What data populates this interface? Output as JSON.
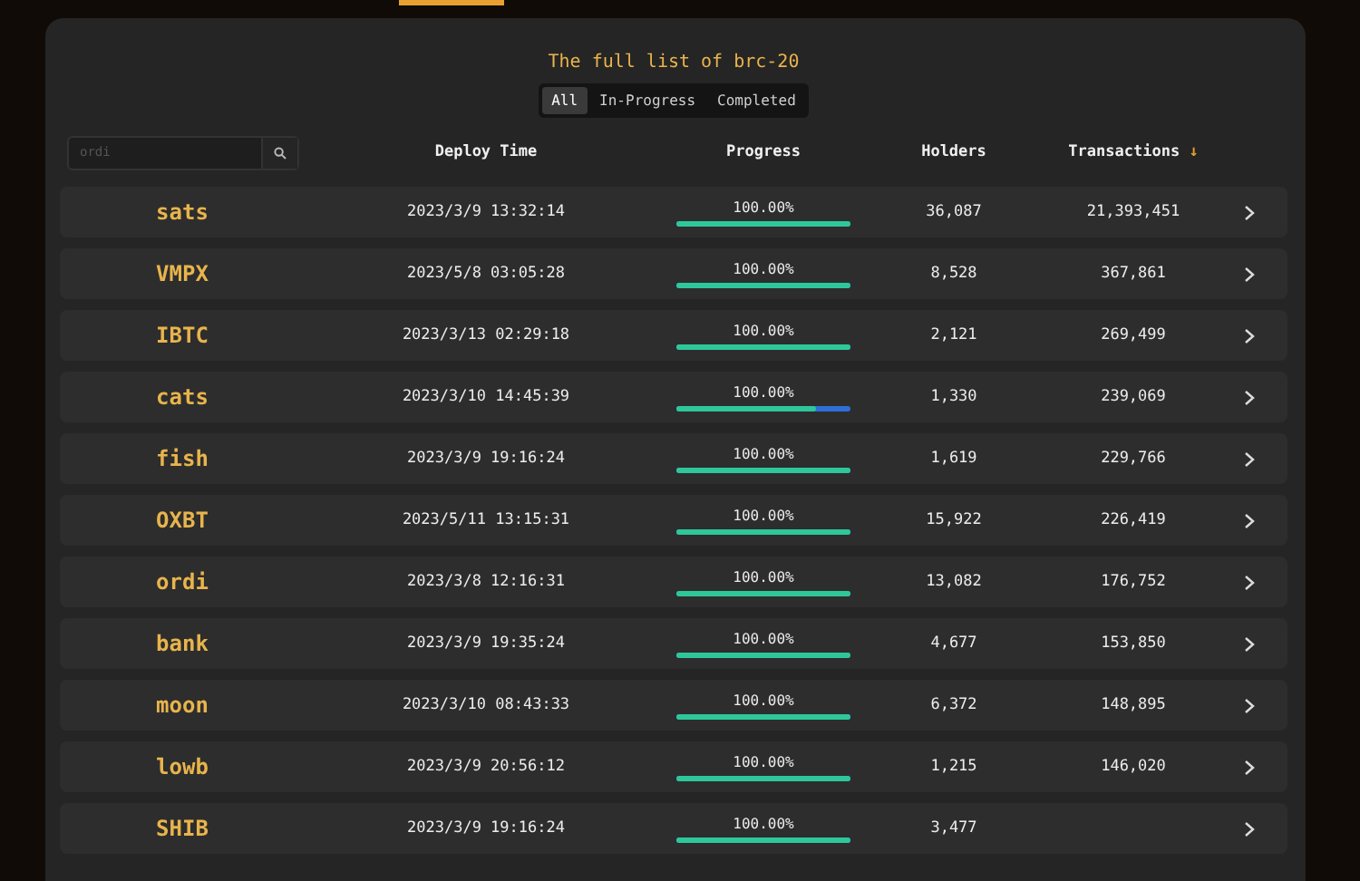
{
  "title": "The full list of brc-20",
  "filters": [
    {
      "label": "All",
      "selected": true
    },
    {
      "label": "In-Progress",
      "selected": false
    },
    {
      "label": "Completed",
      "selected": false
    }
  ],
  "search": {
    "placeholder": "ordi"
  },
  "columns": [
    "Deploy Time",
    "Progress",
    "Holders",
    "Transactions"
  ],
  "sort_indicator": "↓",
  "rows": [
    {
      "name": "sats",
      "deploy_time": "2023/3/9 13:32:14",
      "progress": "100.00%",
      "level": 1,
      "holders": "36,087",
      "transactions": "21,393,451"
    },
    {
      "name": "VMPX",
      "deploy_time": "2023/5/8 03:05:28",
      "progress": "100.00%",
      "level": 1,
      "holders": "8,528",
      "transactions": "367,861"
    },
    {
      "name": "IBTC",
      "deploy_time": "2023/3/13 02:29:18",
      "progress": "100.00%",
      "level": 1,
      "holders": "2,121",
      "transactions": "269,499"
    },
    {
      "name": "cats",
      "deploy_time": "2023/3/10 14:45:39",
      "progress": "100.00%",
      "level": 0.8,
      "holders": "1,330",
      "transactions": "239,069"
    },
    {
      "name": "fish",
      "deploy_time": "2023/3/9 19:16:24",
      "progress": "100.00%",
      "level": 1,
      "holders": "1,619",
      "transactions": "229,766"
    },
    {
      "name": "OXBT",
      "deploy_time": "2023/5/11 13:15:31",
      "progress": "100.00%",
      "level": 1,
      "holders": "15,922",
      "transactions": "226,419"
    },
    {
      "name": "ordi",
      "deploy_time": "2023/3/8 12:16:31",
      "progress": "100.00%",
      "level": 1,
      "holders": "13,082",
      "transactions": "176,752"
    },
    {
      "name": "bank",
      "deploy_time": "2023/3/9 19:35:24",
      "progress": "100.00%",
      "level": 1,
      "holders": "4,677",
      "transactions": "153,850"
    },
    {
      "name": "moon",
      "deploy_time": "2023/3/10 08:43:33",
      "progress": "100.00%",
      "level": 1,
      "holders": "6,372",
      "transactions": "148,895"
    },
    {
      "name": "lowb",
      "deploy_time": "2023/3/9 20:56:12",
      "progress": "100.00%",
      "level": 1,
      "holders": "1,215",
      "transactions": "146,020"
    },
    {
      "name": "SHIB",
      "deploy_time": "2023/3/9 19:16:24",
      "progress": "100.00%",
      "level": 1,
      "holders": "3,477"
    }
  ]
}
